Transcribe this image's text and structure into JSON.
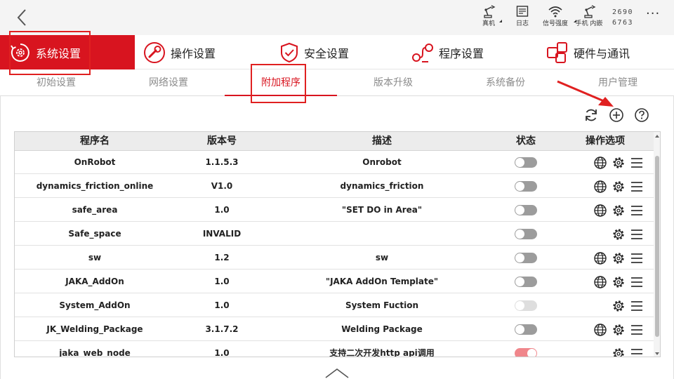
{
  "status_bar": {
    "items": [
      {
        "label": "真机",
        "icon": "robot-arm-icon"
      },
      {
        "label": "日志",
        "icon": "log-icon"
      },
      {
        "label": "信号强度",
        "icon": "wifi-icon"
      },
      {
        "label": "手机 内嵌",
        "icon": "robot-arm-icon"
      }
    ],
    "serial_line1": "2690",
    "serial_line2": "6763",
    "more": "···"
  },
  "main_tabs": [
    {
      "label": "系统设置",
      "icon": "system-settings-icon",
      "active": true
    },
    {
      "label": "操作设置",
      "icon": "operation-settings-icon",
      "active": false
    },
    {
      "label": "安全设置",
      "icon": "shield-check-icon",
      "active": false
    },
    {
      "label": "程序设置",
      "icon": "program-settings-icon",
      "active": false
    },
    {
      "label": "硬件与通讯",
      "icon": "hardware-comm-icon",
      "active": false
    }
  ],
  "sub_tabs": [
    {
      "label": "初始设置",
      "active": false
    },
    {
      "label": "网络设置",
      "active": false
    },
    {
      "label": "附加程序",
      "active": true
    },
    {
      "label": "版本升级",
      "active": false
    },
    {
      "label": "系统备份",
      "active": false
    },
    {
      "label": "用户管理",
      "active": false
    }
  ],
  "toolbar": {
    "refresh": "refresh-icon",
    "add": "add-circle-icon",
    "help": "help-circle-icon"
  },
  "table": {
    "headers": {
      "name": "程序名",
      "version": "版本号",
      "description": "描述",
      "status": "状态",
      "operations": "操作选项"
    },
    "rows": [
      {
        "name": "OnRobot",
        "version": "1.1.5.3",
        "description": "Onrobot",
        "status": "off",
        "has_web": true
      },
      {
        "name": "dynamics_friction_online",
        "version": "V1.0",
        "description": "dynamics_friction",
        "status": "off",
        "has_web": true
      },
      {
        "name": "safe_area",
        "version": "1.0",
        "description": "\"SET DO in Area\"",
        "status": "off",
        "has_web": true
      },
      {
        "name": "Safe_space",
        "version": "INVALID",
        "description": "",
        "status": "off",
        "has_web": false
      },
      {
        "name": "sw",
        "version": "1.2",
        "description": "sw",
        "status": "off",
        "has_web": true
      },
      {
        "name": "JAKA_AddOn",
        "version": "1.0",
        "description": "\"JAKA AddOn Template\"",
        "status": "off",
        "has_web": true
      },
      {
        "name": "System_AddOn",
        "version": "1.0",
        "description": "System Fuction",
        "status": "disabled",
        "has_web": false
      },
      {
        "name": "JK_Welding_Package",
        "version": "3.1.7.2",
        "description": "Welding Package",
        "status": "off",
        "has_web": true
      },
      {
        "name": "jaka_web_node",
        "version": "1.0",
        "description": "支持二次开发http api调用",
        "status": "on",
        "has_web": false
      }
    ]
  },
  "colors": {
    "accent": "#d8141f",
    "highlight_box": "#e02020",
    "toggle_off": "#9c9c9c",
    "toggle_on": "#f0868b",
    "toggle_disabled": "#dedede"
  }
}
